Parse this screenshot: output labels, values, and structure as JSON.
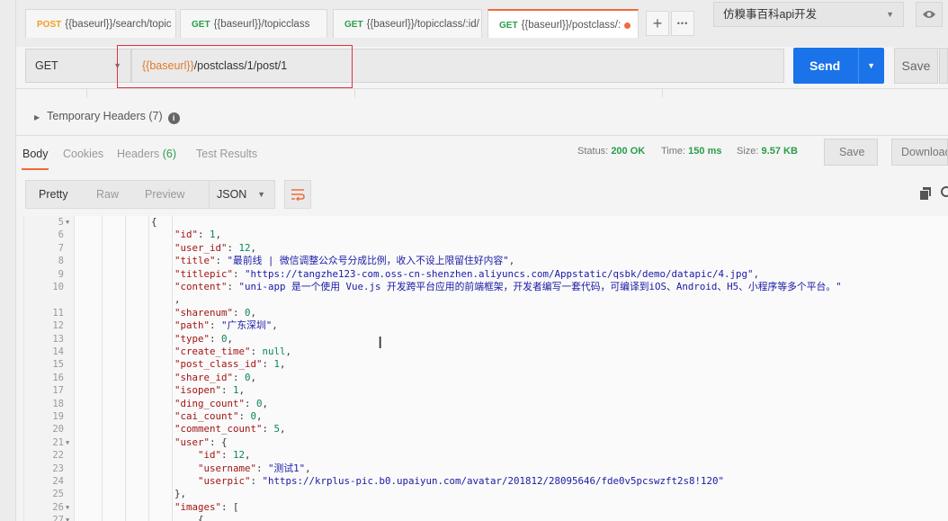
{
  "tabs": [
    {
      "method": "POST",
      "label": "{{baseurl}}/search/topic",
      "active": false,
      "unsaved": false
    },
    {
      "method": "GET",
      "label": "{{baseurl}}/topicclass",
      "active": false,
      "unsaved": false
    },
    {
      "method": "GET",
      "label": "{{baseurl}}/topicclass/:id/",
      "active": false,
      "unsaved": false
    },
    {
      "method": "GET",
      "label": "{{baseurl}}/postclass/:",
      "active": true,
      "unsaved": true
    }
  ],
  "tab_actions": {
    "add_icon": "+",
    "more_icon": "•••"
  },
  "environment": {
    "selected": "仿糗事百科api开发"
  },
  "request": {
    "method": "GET",
    "url_var": "{{baseurl}}",
    "url_path": "/postclass/1/post/1",
    "send_label": "Send",
    "save_label": "Save"
  },
  "temporary_headers": {
    "label": "Temporary Headers (7)"
  },
  "response_tabs": [
    {
      "label": "Body",
      "count": "",
      "active": true
    },
    {
      "label": "Cookies",
      "count": "",
      "active": false
    },
    {
      "label": "Headers",
      "count": "(6)",
      "active": false
    },
    {
      "label": "Test Results",
      "count": "",
      "active": false
    }
  ],
  "response_meta": {
    "status_label": "Status:",
    "status_value": "200 OK",
    "time_label": "Time:",
    "time_value": "150 ms",
    "size_label": "Size:",
    "size_value": "9.57 KB",
    "save_label": "Save",
    "download_label": "Download"
  },
  "viewer": {
    "modes": [
      "Pretty",
      "Raw",
      "Preview"
    ],
    "active_mode": "Pretty",
    "format": "JSON"
  },
  "code_lines": [
    {
      "n": "5",
      "fold": true,
      "indent": 0,
      "t": [
        [
          "p",
          "{"
        ]
      ]
    },
    {
      "n": "6",
      "fold": false,
      "indent": 1,
      "t": [
        [
          "k",
          "\"id\""
        ],
        [
          "p",
          ": "
        ],
        [
          "n",
          "1"
        ],
        [
          "p",
          ","
        ]
      ]
    },
    {
      "n": "7",
      "fold": false,
      "indent": 1,
      "t": [
        [
          "k",
          "\"user_id\""
        ],
        [
          "p",
          ": "
        ],
        [
          "n",
          "12"
        ],
        [
          "p",
          ","
        ]
      ]
    },
    {
      "n": "8",
      "fold": false,
      "indent": 1,
      "t": [
        [
          "k",
          "\"title\""
        ],
        [
          "p",
          ": "
        ],
        [
          "s",
          "\"最前线 | 微信调整公众号分成比例，收入不设上限留住好内容\""
        ],
        [
          "p",
          ","
        ]
      ]
    },
    {
      "n": "9",
      "fold": false,
      "indent": 1,
      "t": [
        [
          "k",
          "\"titlepic\""
        ],
        [
          "p",
          ": "
        ],
        [
          "s",
          "\"https://tangzhe123-com.oss-cn-shenzhen.aliyuncs.com/Appstatic/qsbk/demo/datapic/4.jpg\""
        ],
        [
          "p",
          ","
        ]
      ]
    },
    {
      "n": "10",
      "fold": false,
      "indent": 1,
      "t": [
        [
          "k",
          "\"content\""
        ],
        [
          "p",
          ": "
        ],
        [
          "s",
          "\"uni-app 是一个使用 Vue.js 开发跨平台应用的前端框架，开发者编写一套代码，可编译到iOS、Android、H5、小程序等多个平台。\""
        ]
      ]
    },
    {
      "n": "",
      "fold": false,
      "indent": 1,
      "t": [
        [
          "p",
          ","
        ]
      ]
    },
    {
      "n": "11",
      "fold": false,
      "indent": 1,
      "t": [
        [
          "k",
          "\"sharenum\""
        ],
        [
          "p",
          ": "
        ],
        [
          "n",
          "0"
        ],
        [
          "p",
          ","
        ]
      ]
    },
    {
      "n": "12",
      "fold": false,
      "indent": 1,
      "t": [
        [
          "k",
          "\"path\""
        ],
        [
          "p",
          ": "
        ],
        [
          "s",
          "\"广东深圳\""
        ],
        [
          "p",
          ","
        ]
      ]
    },
    {
      "n": "13",
      "fold": false,
      "indent": 1,
      "t": [
        [
          "k",
          "\"type\""
        ],
        [
          "p",
          ": "
        ],
        [
          "n",
          "0"
        ],
        [
          "p",
          ","
        ]
      ]
    },
    {
      "n": "14",
      "fold": false,
      "indent": 1,
      "t": [
        [
          "k",
          "\"create_time\""
        ],
        [
          "p",
          ": "
        ],
        [
          "n",
          "null"
        ],
        [
          "p",
          ","
        ]
      ]
    },
    {
      "n": "15",
      "fold": false,
      "indent": 1,
      "t": [
        [
          "k",
          "\"post_class_id\""
        ],
        [
          "p",
          ": "
        ],
        [
          "n",
          "1"
        ],
        [
          "p",
          ","
        ]
      ]
    },
    {
      "n": "16",
      "fold": false,
      "indent": 1,
      "t": [
        [
          "k",
          "\"share_id\""
        ],
        [
          "p",
          ": "
        ],
        [
          "n",
          "0"
        ],
        [
          "p",
          ","
        ]
      ]
    },
    {
      "n": "17",
      "fold": false,
      "indent": 1,
      "t": [
        [
          "k",
          "\"isopen\""
        ],
        [
          "p",
          ": "
        ],
        [
          "n",
          "1"
        ],
        [
          "p",
          ","
        ]
      ]
    },
    {
      "n": "18",
      "fold": false,
      "indent": 1,
      "t": [
        [
          "k",
          "\"ding_count\""
        ],
        [
          "p",
          ": "
        ],
        [
          "n",
          "0"
        ],
        [
          "p",
          ","
        ]
      ]
    },
    {
      "n": "19",
      "fold": false,
      "indent": 1,
      "t": [
        [
          "k",
          "\"cai_count\""
        ],
        [
          "p",
          ": "
        ],
        [
          "n",
          "0"
        ],
        [
          "p",
          ","
        ]
      ]
    },
    {
      "n": "20",
      "fold": false,
      "indent": 1,
      "t": [
        [
          "k",
          "\"comment_count\""
        ],
        [
          "p",
          ": "
        ],
        [
          "n",
          "5"
        ],
        [
          "p",
          ","
        ]
      ]
    },
    {
      "n": "21",
      "fold": true,
      "indent": 1,
      "t": [
        [
          "k",
          "\"user\""
        ],
        [
          "p",
          ": {"
        ]
      ]
    },
    {
      "n": "22",
      "fold": false,
      "indent": 2,
      "t": [
        [
          "k",
          "\"id\""
        ],
        [
          "p",
          ": "
        ],
        [
          "n",
          "12"
        ],
        [
          "p",
          ","
        ]
      ]
    },
    {
      "n": "23",
      "fold": false,
      "indent": 2,
      "t": [
        [
          "k",
          "\"username\""
        ],
        [
          "p",
          ": "
        ],
        [
          "s",
          "\"测试1\""
        ],
        [
          "p",
          ","
        ]
      ]
    },
    {
      "n": "24",
      "fold": false,
      "indent": 2,
      "t": [
        [
          "k",
          "\"userpic\""
        ],
        [
          "p",
          ": "
        ],
        [
          "s",
          "\"https://krplus-pic.b0.upaiyun.com/avatar/201812/28095646/fde0v5pcswzft2s8!120\""
        ]
      ]
    },
    {
      "n": "25",
      "fold": false,
      "indent": 1,
      "t": [
        [
          "p",
          "},"
        ]
      ]
    },
    {
      "n": "26",
      "fold": true,
      "indent": 1,
      "t": [
        [
          "k",
          "\"images\""
        ],
        [
          "p",
          ": ["
        ]
      ]
    },
    {
      "n": "27",
      "fold": true,
      "indent": 2,
      "t": [
        [
          "p",
          "{"
        ]
      ]
    }
  ]
}
